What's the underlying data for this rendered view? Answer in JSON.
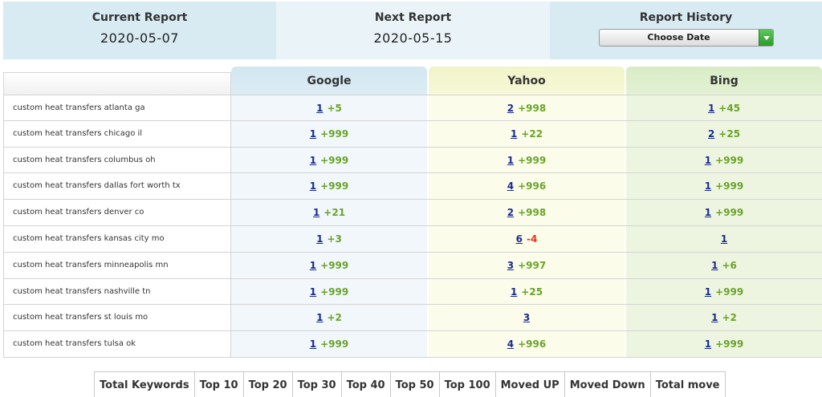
{
  "header": {
    "current_report_label": "Current Report",
    "current_report_date": "2020-05-07",
    "next_report_label": "Next Report",
    "next_report_date": "2020-05-15",
    "report_history_label": "Report History",
    "choose_date_label": "Choose Date"
  },
  "table": {
    "columns": [
      "Google",
      "Yahoo",
      "Bing"
    ],
    "rows": [
      {
        "keyword": "custom heat transfers atlanta ga",
        "google": {
          "rank": "1",
          "change": "+5"
        },
        "yahoo": {
          "rank": "2",
          "change": "+998"
        },
        "bing": {
          "rank": "1",
          "change": "+45"
        }
      },
      {
        "keyword": "custom heat transfers chicago il",
        "google": {
          "rank": "1",
          "change": "+999"
        },
        "yahoo": {
          "rank": "1",
          "change": "+22"
        },
        "bing": {
          "rank": "2",
          "change": "+25"
        }
      },
      {
        "keyword": "custom heat transfers columbus oh",
        "google": {
          "rank": "1",
          "change": "+999"
        },
        "yahoo": {
          "rank": "1",
          "change": "+999"
        },
        "bing": {
          "rank": "1",
          "change": "+999"
        }
      },
      {
        "keyword": "custom heat transfers dallas fort worth tx",
        "google": {
          "rank": "1",
          "change": "+999"
        },
        "yahoo": {
          "rank": "4",
          "change": "+996"
        },
        "bing": {
          "rank": "1",
          "change": "+999"
        }
      },
      {
        "keyword": "custom heat transfers denver co",
        "google": {
          "rank": "1",
          "change": "+21"
        },
        "yahoo": {
          "rank": "2",
          "change": "+998"
        },
        "bing": {
          "rank": "1",
          "change": "+999"
        }
      },
      {
        "keyword": "custom heat transfers kansas city mo",
        "google": {
          "rank": "1",
          "change": "+3"
        },
        "yahoo": {
          "rank": "6",
          "change": "-4"
        },
        "bing": {
          "rank": "1",
          "change": ""
        }
      },
      {
        "keyword": "custom heat transfers minneapolis mn",
        "google": {
          "rank": "1",
          "change": "+999"
        },
        "yahoo": {
          "rank": "3",
          "change": "+997"
        },
        "bing": {
          "rank": "1",
          "change": "+6"
        }
      },
      {
        "keyword": "custom heat transfers nashville tn",
        "google": {
          "rank": "1",
          "change": "+999"
        },
        "yahoo": {
          "rank": "1",
          "change": "+25"
        },
        "bing": {
          "rank": "1",
          "change": "+999"
        }
      },
      {
        "keyword": "custom heat transfers st louis mo",
        "google": {
          "rank": "1",
          "change": "+2"
        },
        "yahoo": {
          "rank": "3",
          "change": ""
        },
        "bing": {
          "rank": "1",
          "change": "+2"
        }
      },
      {
        "keyword": "custom heat transfers tulsa ok",
        "google": {
          "rank": "1",
          "change": "+999"
        },
        "yahoo": {
          "rank": "4",
          "change": "+996"
        },
        "bing": {
          "rank": "1",
          "change": "+999"
        }
      }
    ]
  },
  "summary": {
    "tabs": [
      "Total Keywords",
      "Top 10",
      "Top 20",
      "Top 30",
      "Top 40",
      "Top 50",
      "Top 100",
      "Moved UP",
      "Moved Down",
      "Total move"
    ]
  },
  "colors": {
    "positive_change": "#6aa32a",
    "negative_change": "#e2361c",
    "rank_link": "#1a2b8c",
    "google_column": "#f1f7fb",
    "yahoo_column": "#fbfdea",
    "bing_column": "#edf5e1"
  },
  "icons": {
    "dropdown": "chevron-down-icon"
  }
}
